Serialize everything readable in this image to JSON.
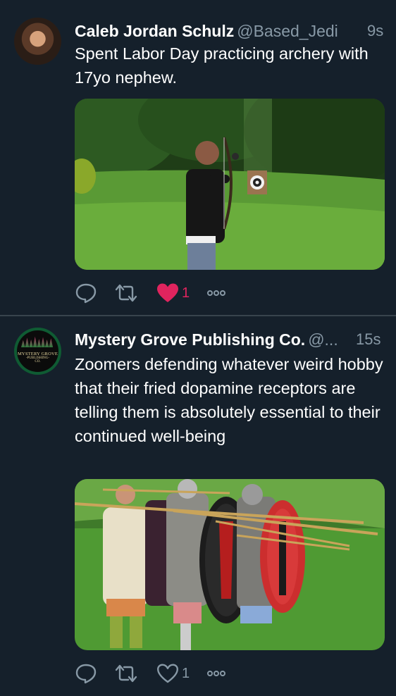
{
  "tweets": [
    {
      "name": "Caleb Jordan Schulz",
      "handle": "@Based_Jedi",
      "time": "9s",
      "text": "Spent Labor Day practicing archery with 17yo nephew.",
      "like_count": "1",
      "liked": true
    },
    {
      "name": "Mystery Grove Publishing Co.",
      "handle": "@...",
      "time": "15s",
      "text": "Zoomers defending whatever weird hobby that their fried dopamine receptors are telling them is absolutely essential to their continued well-being",
      "like_count": "1",
      "liked": false,
      "logo_text_1": "MYSTERY GROVE",
      "logo_text_2": "-PUBLISHING-",
      "logo_text_3": "CO."
    }
  ],
  "icons": [
    "reply-icon",
    "retweet-icon",
    "like-icon",
    "more-icon"
  ],
  "colors": {
    "background": "#15202b",
    "divider": "#38444d",
    "secondary_text": "#8899a6",
    "like_red": "#e0245e"
  }
}
